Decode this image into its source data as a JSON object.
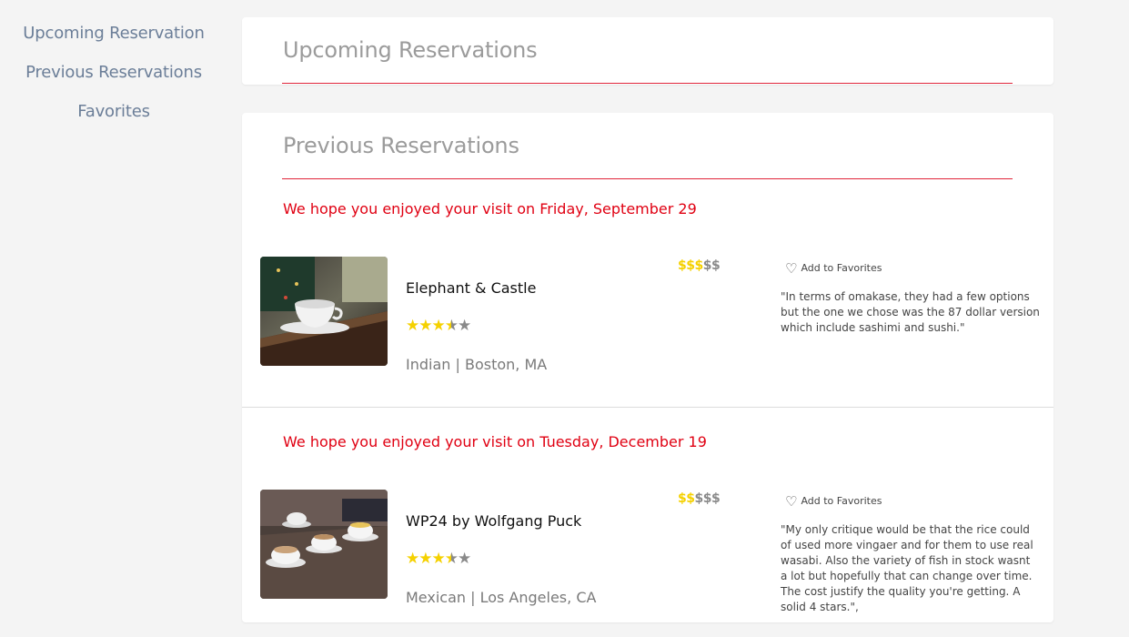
{
  "sidebar": {
    "items": [
      {
        "label": "Upcoming Reservation"
      },
      {
        "label": "Previous Reservations"
      },
      {
        "label": "Favorites"
      }
    ]
  },
  "upcoming": {
    "title": "Upcoming Reservations"
  },
  "previous": {
    "title": "Previous Reservations",
    "reservations": [
      {
        "visit_message": "We hope you enjoyed your visit on Friday, September 29",
        "name": "Elephant & Castle",
        "rating": 3.5,
        "price_level": 3,
        "price_max": 5,
        "cuisine_location": "Indian | Boston, MA",
        "favorite_label": "Add to Favorites",
        "review": "\"In terms of omakase, they had a few options but the one we chose was the 87 dollar version which include sashimi and sushi.\""
      },
      {
        "visit_message": "We hope you enjoyed your visit on Tuesday, December 19",
        "name": "WP24 by Wolfgang Puck",
        "rating": 3.5,
        "price_level": 2,
        "price_max": 5,
        "cuisine_location": "Mexican | Los Angeles, CA",
        "favorite_label": "Add to Favorites",
        "review": "\"My only critique would be that the rice could of used more vingaer and for them to use real wasabi. Also the variety of fish in stock wasnt a lot but hopefully that can change over time. The cost justify the quality you're getting. A solid 4 stars.\","
      }
    ]
  },
  "colors": {
    "accent_red": "#e00012",
    "rule_red": "#e0253a",
    "star_gold": "#f5d100",
    "link_blue_gray": "#6b7e98"
  },
  "icons": {
    "favorite": "heart-outline-icon",
    "star": "star-icon"
  }
}
